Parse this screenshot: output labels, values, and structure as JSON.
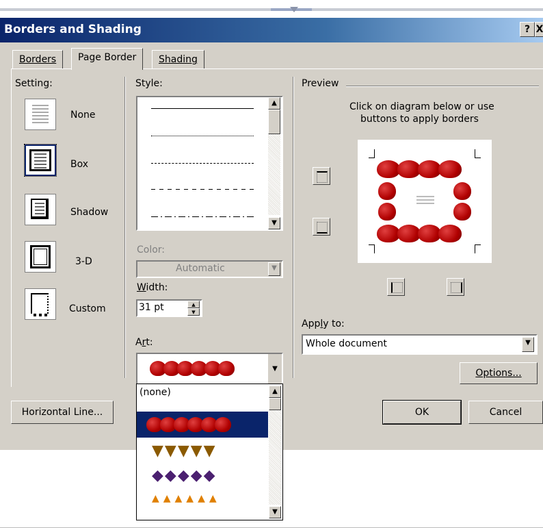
{
  "window": {
    "title": "Borders and Shading",
    "help_btn": "?",
    "close_btn": "X"
  },
  "tabs": [
    {
      "label": "Borders",
      "active": false
    },
    {
      "label": "Page Border",
      "active": true
    },
    {
      "label": "Shading",
      "active": false
    }
  ],
  "setting": {
    "label": "Setting:",
    "options": [
      {
        "label": "None",
        "icon": "setting-none-icon"
      },
      {
        "label": "Box",
        "icon": "setting-box-icon",
        "selected": true
      },
      {
        "label": "Shadow",
        "icon": "setting-shadow-icon"
      },
      {
        "label": "3-D",
        "icon": "setting-3d-icon"
      },
      {
        "label": "Custom",
        "icon": "setting-custom-icon"
      }
    ]
  },
  "style": {
    "label": "Style:"
  },
  "color": {
    "label": "Color:",
    "value": "Automatic"
  },
  "width": {
    "label": "Width:",
    "value": "31 pt"
  },
  "art": {
    "label": "Art:",
    "selected": "apples",
    "dropdown": {
      "none_label": "(none)",
      "items": [
        "apples",
        "ice-cream-cones",
        "cakes",
        "candy-corn"
      ]
    }
  },
  "preview": {
    "label": "Preview",
    "instructions_line1": "Click on diagram below or use",
    "instructions_line2": "buttons to apply borders"
  },
  "apply_to": {
    "label": "Apply to:",
    "value": "Whole document"
  },
  "buttons": {
    "options": "Options...",
    "horizontal_line": "Horizontal Line...",
    "ok": "OK",
    "cancel": "Cancel"
  },
  "colors": {
    "title_bar": "#0a246a",
    "dialog_bg": "#d4d0c8",
    "selection": "#0a246a",
    "apple": "#c00000"
  }
}
